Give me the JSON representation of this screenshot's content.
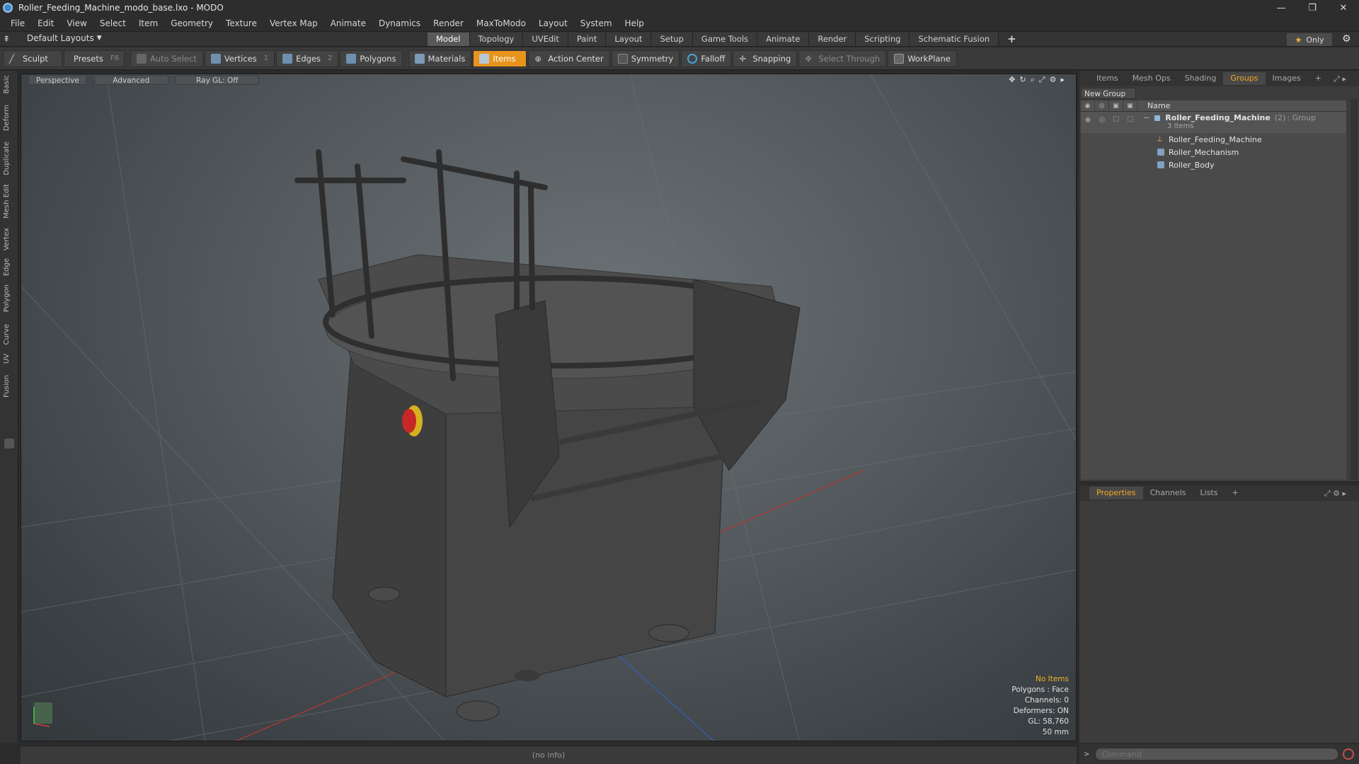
{
  "window": {
    "title": "Roller_Feeding_Machine_modo_base.lxo - MODO",
    "controls": [
      "—",
      "❐",
      "✕"
    ]
  },
  "menu": [
    "File",
    "Edit",
    "View",
    "Select",
    "Item",
    "Geometry",
    "Texture",
    "Vertex Map",
    "Animate",
    "Dynamics",
    "Render",
    "MaxToModo",
    "Layout",
    "System",
    "Help"
  ],
  "layout_selector": "Default Layouts",
  "mode_tabs": [
    "Model",
    "Topology",
    "UVEdit",
    "Paint",
    "Layout",
    "Setup",
    "Game Tools",
    "Animate",
    "Render",
    "Scripting",
    "Schematic Fusion"
  ],
  "active_mode_tab": "Model",
  "only_label": "Only",
  "toolbar": {
    "sculpt": "Sculpt",
    "presets": "Presets",
    "presets_key": "F6",
    "auto_select": "Auto Select",
    "vertices": "Vertices",
    "vertices_count": "1",
    "edges": "Edges",
    "edges_count": "2",
    "polygons": "Polygons",
    "materials": "Materials",
    "items": "Items",
    "action_center": "Action Center",
    "symmetry": "Symmetry",
    "falloff": "Falloff",
    "snapping": "Snapping",
    "select_through": "Select Through",
    "workplane": "WorkPlane"
  },
  "left_tabs": [
    "Basic",
    "Deform",
    "Duplicate",
    "Mesh Edit",
    "Vertex",
    "Edge",
    "Polygon",
    "Curve",
    "UV",
    "Fusion"
  ],
  "viewport": {
    "view": "Perspective",
    "shading": "Advanced",
    "raygl": "Ray GL: Off",
    "info": {
      "no_items": "No Items",
      "polygons": "Polygons : Face",
      "channels": "Channels: 0",
      "deformers": "Deformers: ON",
      "gl": "GL: 58,760",
      "scale": "50 mm"
    }
  },
  "status_text": "(no info)",
  "right_tabs": [
    "Items",
    "Mesh Ops",
    "Shading",
    "Groups",
    "Images"
  ],
  "active_right_tab": "Groups",
  "new_group": "New Group",
  "list_header": "Name",
  "groups": {
    "root": {
      "name": "Roller_Feeding_Machine",
      "count": "(2)",
      "type": ": Group",
      "sub": "3 Items"
    },
    "children": [
      "Roller_Feeding_Machine",
      "Roller_Mechanism",
      "Roller_Body"
    ]
  },
  "bottom_tabs": [
    "Properties",
    "Channels",
    "Lists"
  ],
  "active_bottom_tab": "Properties",
  "command_placeholder": "Command"
}
